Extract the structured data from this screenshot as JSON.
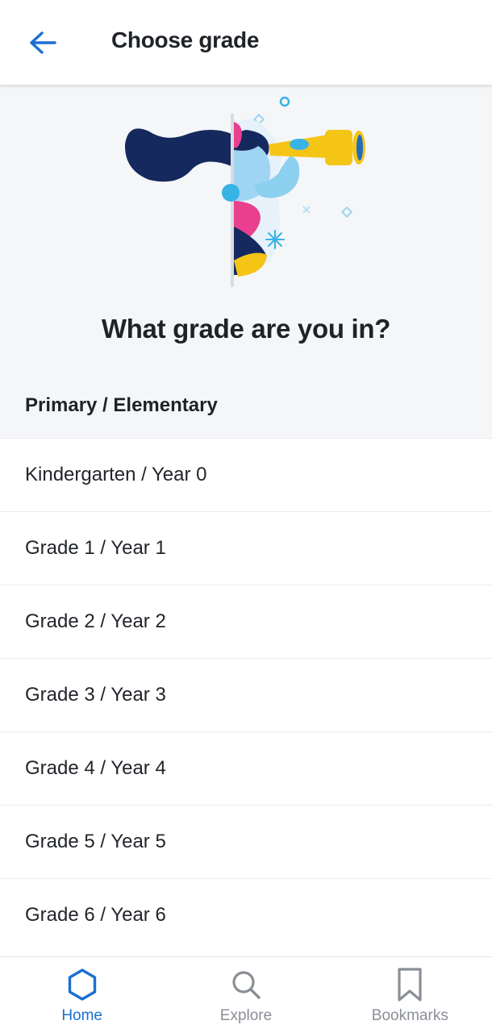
{
  "header": {
    "back_icon": "arrow-left-icon",
    "title": "Choose grade"
  },
  "hero": {
    "illustration": "girl-with-telescope-illustration",
    "question": "What grade are you in?"
  },
  "section": {
    "title": "Primary / Elementary"
  },
  "grades": [
    "Kindergarten / Year 0",
    "Grade 1 / Year 1",
    "Grade 2 / Year 2",
    "Grade 3 / Year 3",
    "Grade 4 / Year 4",
    "Grade 5 / Year 5",
    "Grade 6 / Year 6"
  ],
  "bottom_nav": {
    "tabs": [
      {
        "label": "Home",
        "icon": "hexagon-icon",
        "active": true
      },
      {
        "label": "Explore",
        "icon": "search-icon",
        "active": false
      },
      {
        "label": "Bookmarks",
        "icon": "bookmark-icon",
        "active": false
      }
    ]
  },
  "colors": {
    "accent": "#1c6fd1",
    "inactive": "#8a8f96",
    "hero_bg": "#f5f6f8",
    "text": "#1f2328"
  }
}
